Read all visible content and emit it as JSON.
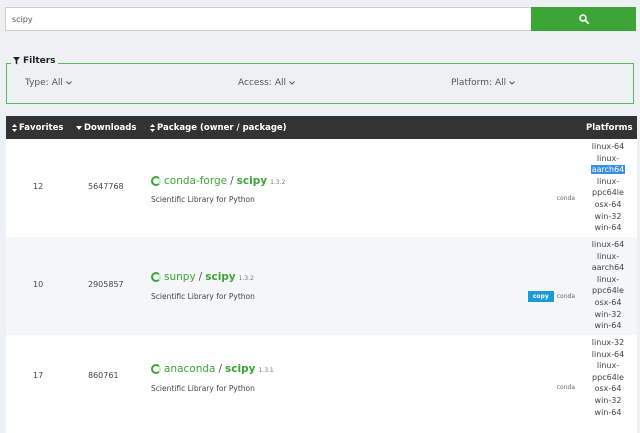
{
  "search": {
    "value": "scipy",
    "button_icon": "search-icon"
  },
  "filters": {
    "legend": "Filters",
    "type": {
      "label": "Type:",
      "value": "All"
    },
    "access": {
      "label": "Access:",
      "value": "All"
    },
    "platform": {
      "label": "Platform:",
      "value": "All"
    }
  },
  "table": {
    "headers": {
      "favorites": "Favorites",
      "downloads": "Downloads",
      "package": "Package (owner / package)",
      "platforms": "Platforms"
    },
    "rows": [
      {
        "favorites": "12",
        "downloads": "5647768",
        "owner": "conda-forge",
        "package": "scipy",
        "version": "1.3.2",
        "description": "Scientific Library for Python",
        "badges": {
          "copy": "",
          "conda": "conda"
        },
        "platforms": [
          "linux-64",
          "linux-",
          "aarch64",
          "linux-",
          "ppc64le",
          "osx-64",
          "win-32",
          "win-64"
        ]
      },
      {
        "favorites": "10",
        "downloads": "2905857",
        "owner": "sunpy",
        "package": "scipy",
        "version": "1.3.2",
        "description": "Scientific Library for Python",
        "badges": {
          "copy": "copy",
          "conda": "conda"
        },
        "platforms": [
          "linux-64",
          "linux-",
          "aarch64",
          "linux-",
          "ppc64le",
          "osx-64",
          "win-32",
          "win-64"
        ]
      },
      {
        "favorites": "17",
        "downloads": "860761",
        "owner": "anaconda",
        "package": "scipy",
        "version": "1.3.1",
        "description": "Scientific Library for Python",
        "badges": {
          "copy": "",
          "conda": "conda"
        },
        "platforms": [
          "linux-32",
          "linux-64",
          "linux-",
          "ppc64le",
          "osx-64",
          "win-32",
          "win-64"
        ]
      }
    ]
  },
  "colors": {
    "accent": "#3ca536",
    "header_bg": "#333333",
    "copy_badge": "#1a9ad6",
    "selection": "#3a8ee6"
  }
}
